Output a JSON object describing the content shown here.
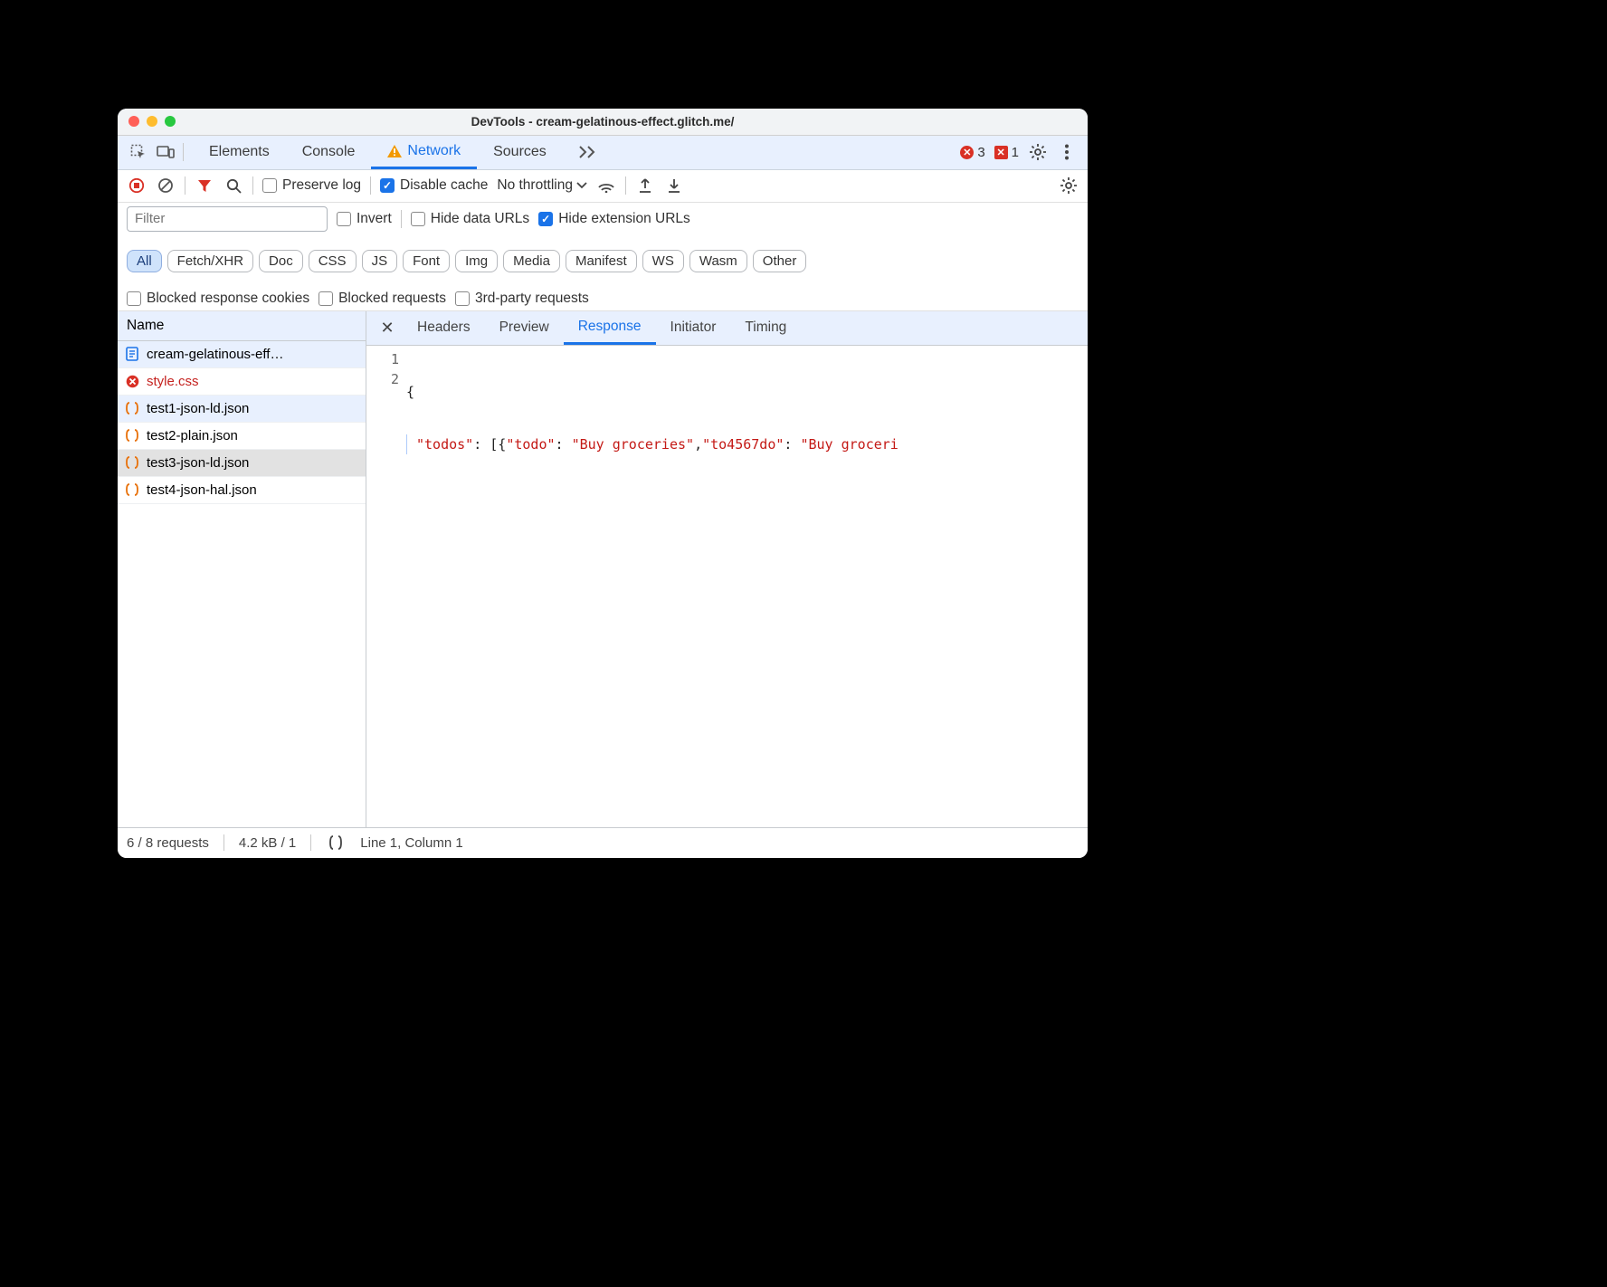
{
  "window": {
    "title": "DevTools - cream-gelatinous-effect.glitch.me/"
  },
  "main_tabs": {
    "items": [
      "Elements",
      "Console",
      "Network",
      "Sources"
    ],
    "active": "Network",
    "overflow_icon": "chevron-double-right-icon"
  },
  "counters": {
    "errors": 3,
    "issues": 1
  },
  "net_toolbar": {
    "preserve_log_label": "Preserve log",
    "disable_cache_label": "Disable cache",
    "disable_cache_checked": true,
    "throttling_label": "No throttling"
  },
  "filter_row": {
    "filter_placeholder": "Filter",
    "invert_label": "Invert",
    "hide_data_urls_label": "Hide data URLs",
    "hide_extension_urls_label": "Hide extension URLs",
    "hide_extension_urls_checked": true
  },
  "type_filters": [
    "All",
    "Fetch/XHR",
    "Doc",
    "CSS",
    "JS",
    "Font",
    "Img",
    "Media",
    "Manifest",
    "WS",
    "Wasm",
    "Other"
  ],
  "type_filter_active": "All",
  "extra_filters": {
    "blocked_response_cookies": "Blocked response cookies",
    "blocked_requests": "Blocked requests",
    "third_party": "3rd-party requests"
  },
  "requests": {
    "header": "Name",
    "items": [
      {
        "name": "cream-gelatinous-eff…",
        "icon": "document-icon",
        "status": "ok",
        "highlight": true
      },
      {
        "name": "style.css",
        "icon": "error-icon",
        "status": "error"
      },
      {
        "name": "test1-json-ld.json",
        "icon": "json-icon",
        "status": "ok",
        "highlight": true
      },
      {
        "name": "test2-plain.json",
        "icon": "json-icon",
        "status": "ok"
      },
      {
        "name": "test3-json-ld.json",
        "icon": "json-icon",
        "status": "ok",
        "selected": true
      },
      {
        "name": "test4-json-hal.json",
        "icon": "json-icon",
        "status": "ok"
      }
    ]
  },
  "detail_tabs": {
    "items": [
      "Headers",
      "Preview",
      "Response",
      "Initiator",
      "Timing"
    ],
    "active": "Response"
  },
  "response_code": {
    "line_numbers": [
      "1",
      "2"
    ],
    "line1": "{",
    "line2_tokens": {
      "k1": "\"todos\"",
      "p1": ": [{",
      "k2": "\"todo\"",
      "p2": ": ",
      "s1": "\"Buy groceries\"",
      "p3": ",",
      "k3": "\"to4567do\"",
      "p4": ": ",
      "s2": "\"Buy groceri"
    }
  },
  "status_bar": {
    "requests": "6 / 8 requests",
    "transfer": "4.2 kB / 1",
    "cursor": "Line 1, Column 1"
  }
}
